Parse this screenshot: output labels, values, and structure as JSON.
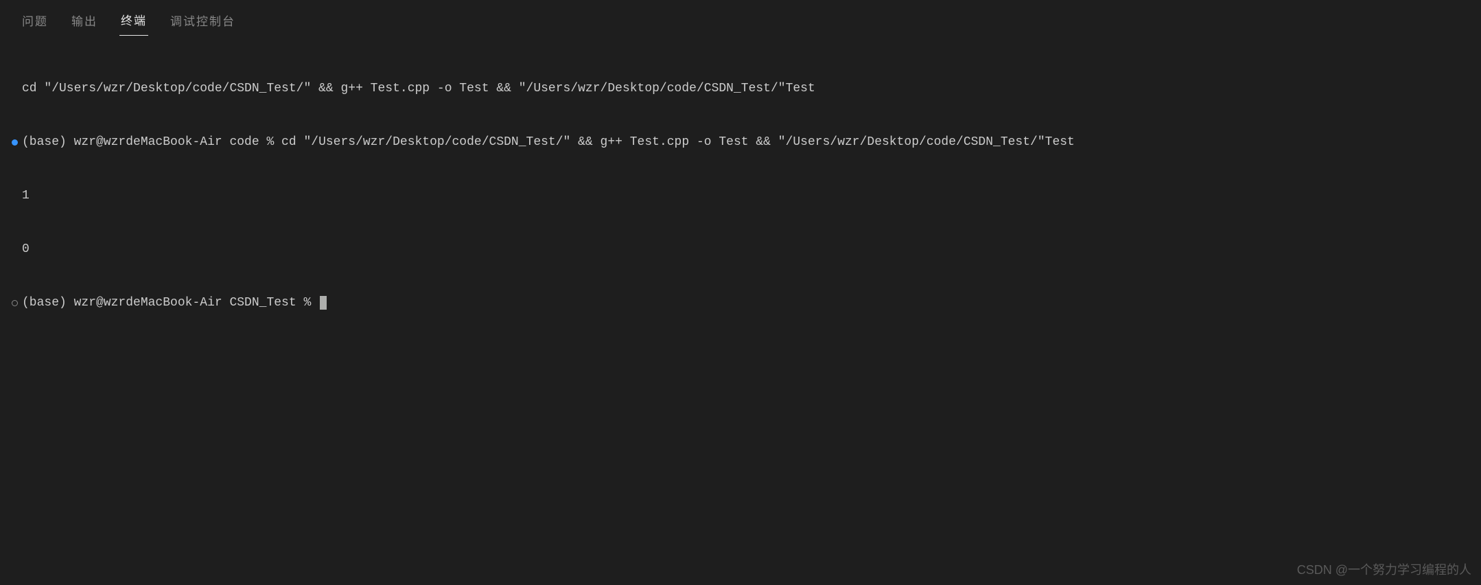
{
  "tabs": {
    "problems": "问题",
    "output": "输出",
    "terminal": "终端",
    "debug_console": "调试控制台"
  },
  "terminal": {
    "lines": [
      "cd \"/Users/wzr/Desktop/code/CSDN_Test/\" && g++ Test.cpp -o Test && \"/Users/wzr/Desktop/code/CSDN_Test/\"Test",
      "(base) wzr@wzrdeMacBook-Air code % cd \"/Users/wzr/Desktop/code/CSDN_Test/\" && g++ Test.cpp -o Test && \"/Users/wzr/Desktop/code/CSDN_Test/\"Test",
      "1",
      "0",
      "(base) wzr@wzrdeMacBook-Air CSDN_Test % "
    ]
  },
  "watermark": "CSDN @一个努力学习编程的人"
}
